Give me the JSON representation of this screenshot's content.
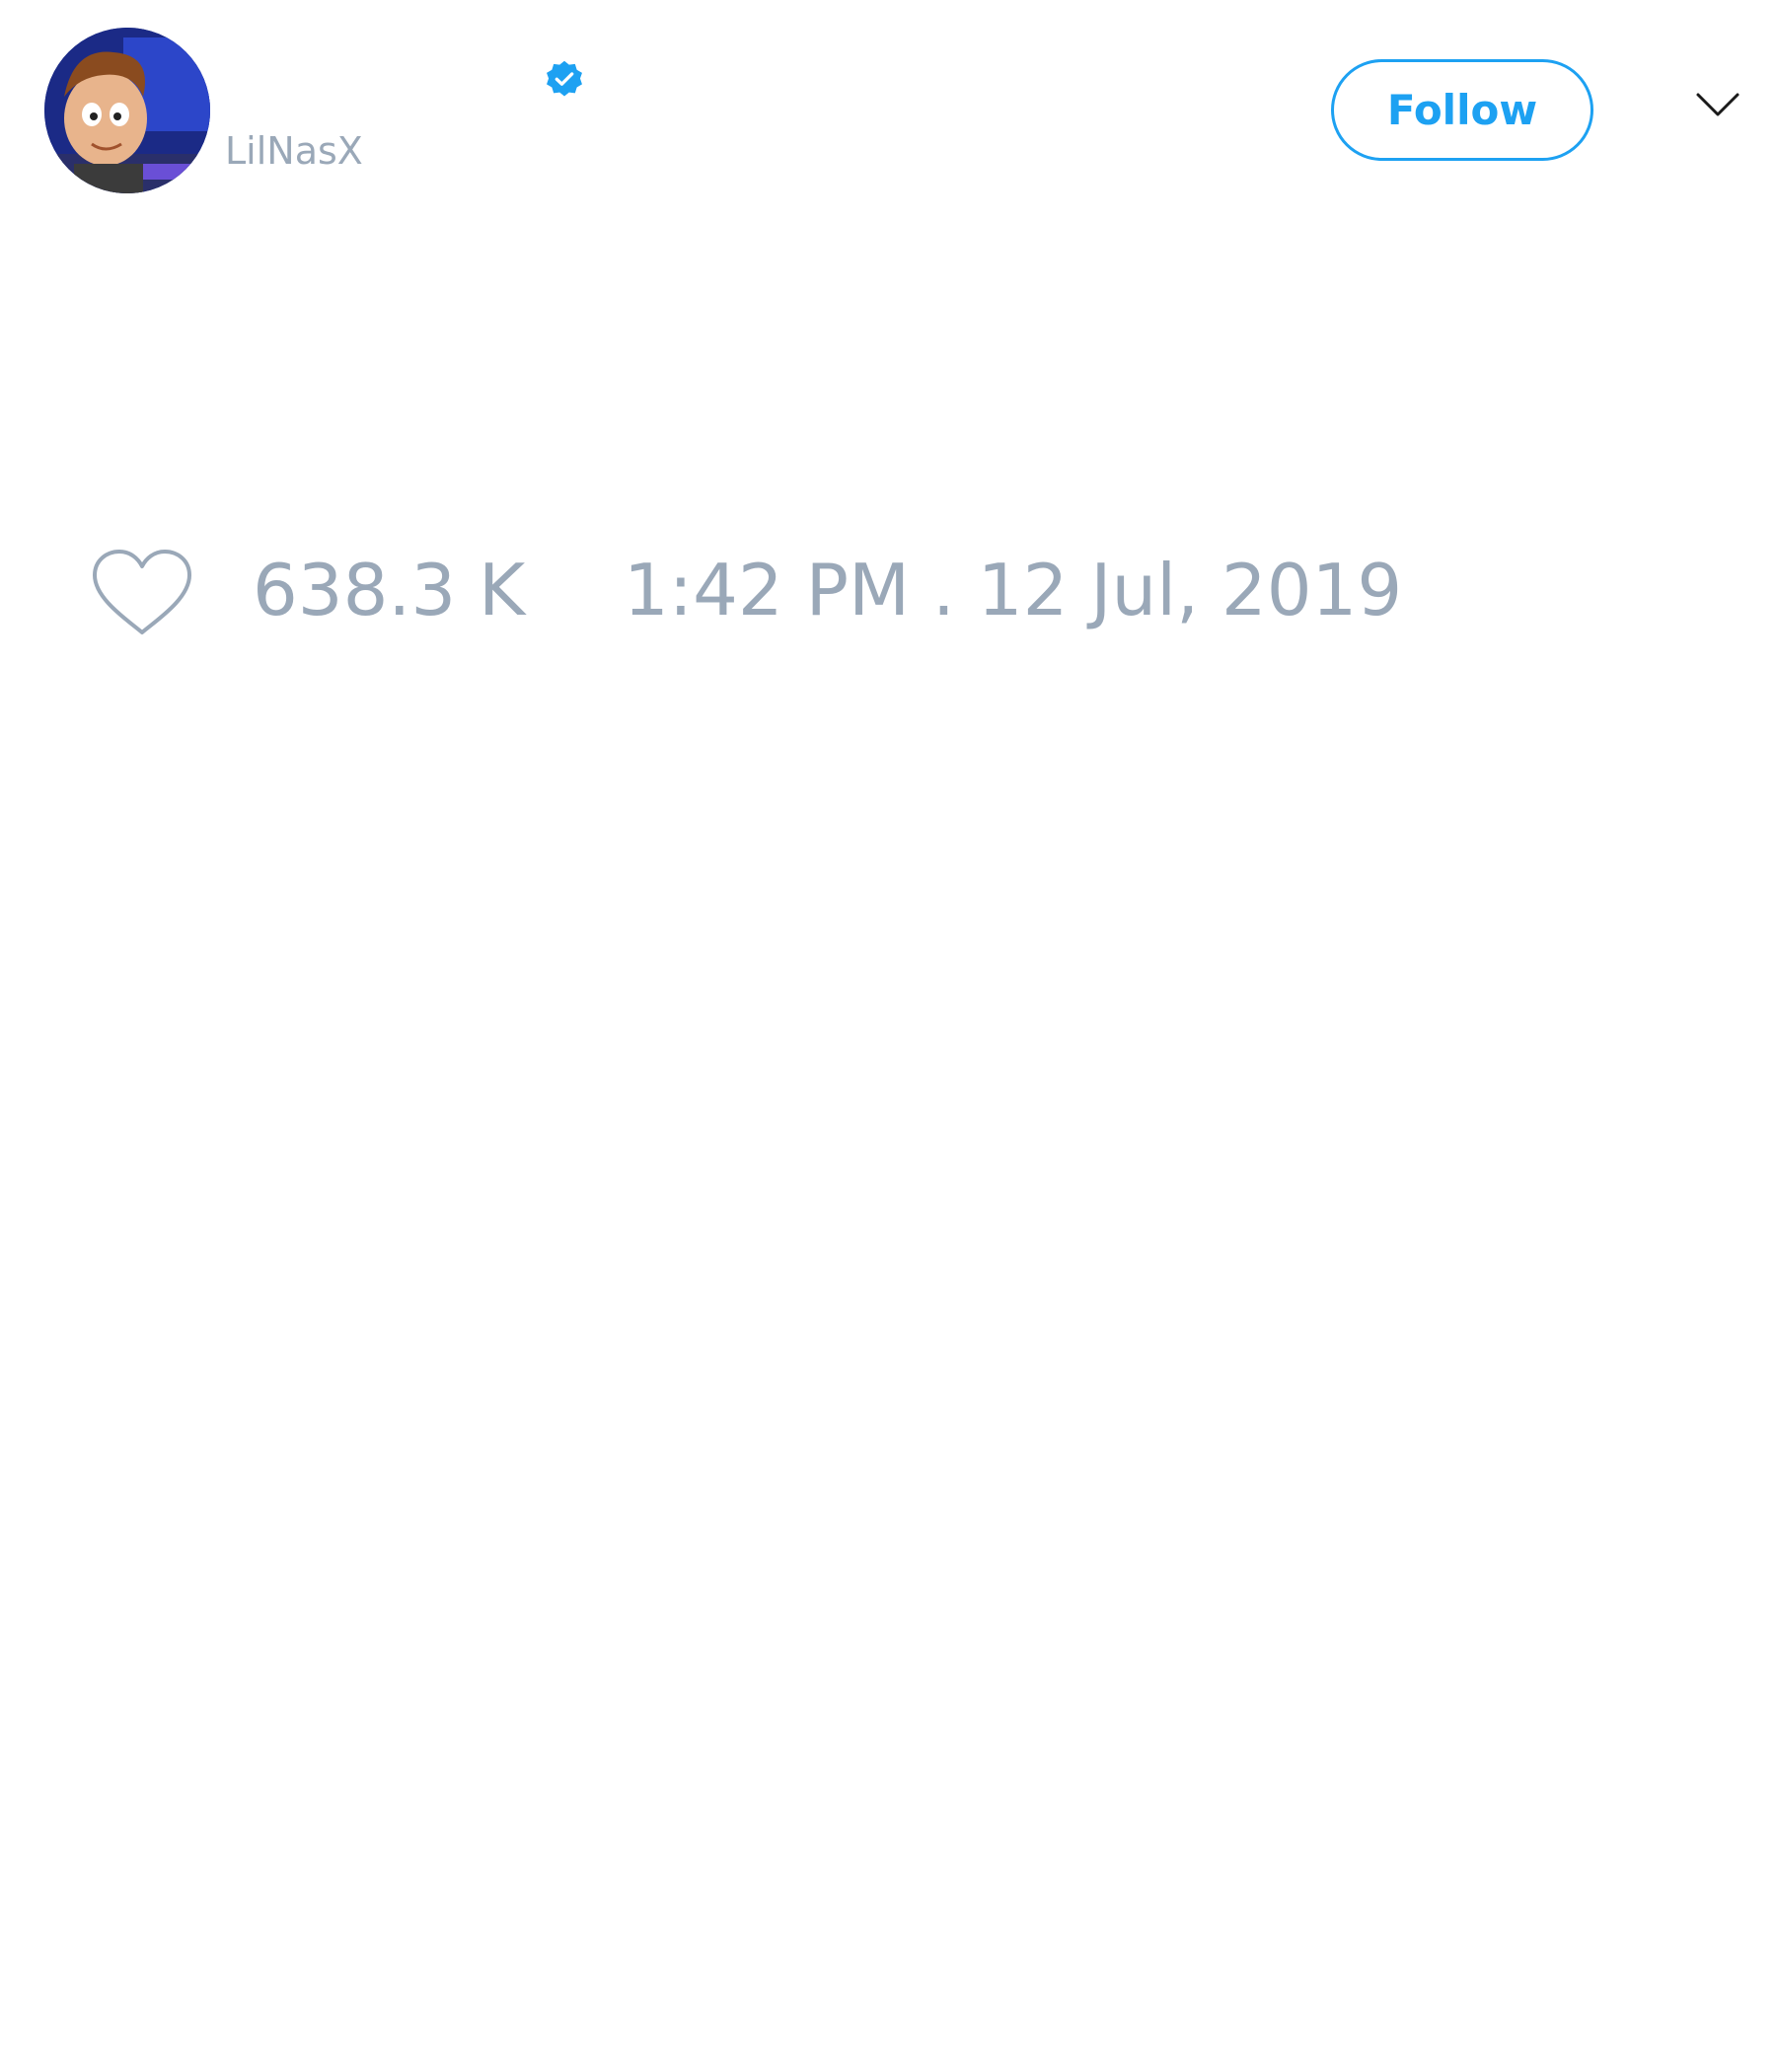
{
  "tweet": {
    "author": {
      "handle": "LilNasX",
      "verified": true,
      "avatar_icon": "cartoon-avatar"
    },
    "follow_label": "Follow",
    "menu_icon": "chevron-down-icon",
    "likes": {
      "icon": "heart-icon",
      "count": "638.3 K"
    },
    "timestamp": "1:42 PM . 12 Jul, 2019"
  },
  "colors": {
    "accent": "#1da1f2",
    "muted_text": "#9aa8b8",
    "background": "#ffffff"
  }
}
